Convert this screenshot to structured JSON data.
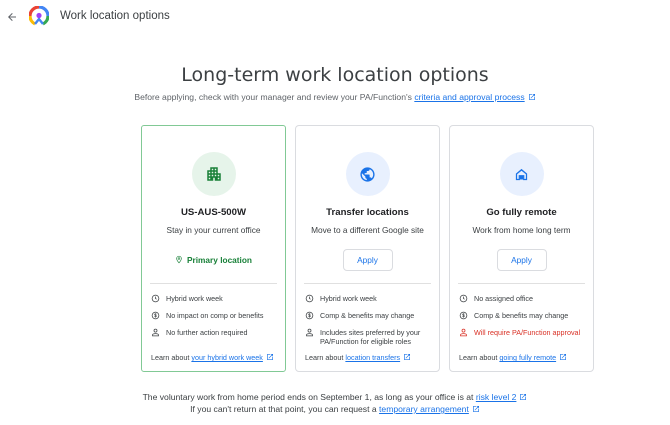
{
  "header": {
    "title": "Work location options"
  },
  "main": {
    "heading": "Long-term work location options",
    "subtitle_prefix": "Before applying, check with your manager and review your PA/Function's ",
    "subtitle_link": "criteria and approval process"
  },
  "cards": [
    {
      "title": "US-AUS-500W",
      "description": "Stay in your current office",
      "status": "Primary location",
      "features": [
        "Hybrid work week",
        "No impact on comp or benefits",
        "No further action required"
      ],
      "learn_prefix": "Learn about ",
      "learn_link": "your hybrid work week"
    },
    {
      "title": "Transfer locations",
      "description": "Move to a different Google site",
      "button": "Apply",
      "features": [
        "Hybrid work week",
        "Comp & benefits may change",
        "Includes sites preferred by your PA/Function for eligible roles"
      ],
      "learn_prefix": "Learn about ",
      "learn_link": "location transfers"
    },
    {
      "title": "Go fully remote",
      "description": "Work from home long term",
      "button": "Apply",
      "features": [
        "No assigned office",
        "Comp & benefits may change",
        "Will require PA/Function approval"
      ],
      "learn_prefix": "Learn about ",
      "learn_link": "going fully remote"
    }
  ],
  "footer": {
    "line1_prefix": "The voluntary work from home period ends on September 1, as long as your office is at ",
    "line1_link": "risk level 2",
    "line2_prefix": "If you can't return at that point, you can request a ",
    "line2_link": "temporary arrangement"
  },
  "colors": {
    "link": "#1a73e8",
    "primary_green": "#188038",
    "warning_red": "#d93025",
    "selected_border": "#81c995",
    "green_badge_bg": "#e6f4ea",
    "blue_badge_bg": "#e8f0fe"
  },
  "icons": {
    "back": "arrow-back-icon",
    "logo": "location-pin-logo",
    "external": "open-in-new-icon",
    "card1": "office-building-icon",
    "card2": "globe-icon",
    "card3": "home-icon",
    "features": [
      "clock-icon",
      "dollar-icon",
      "person-icon",
      "warning-person-icon"
    ]
  }
}
